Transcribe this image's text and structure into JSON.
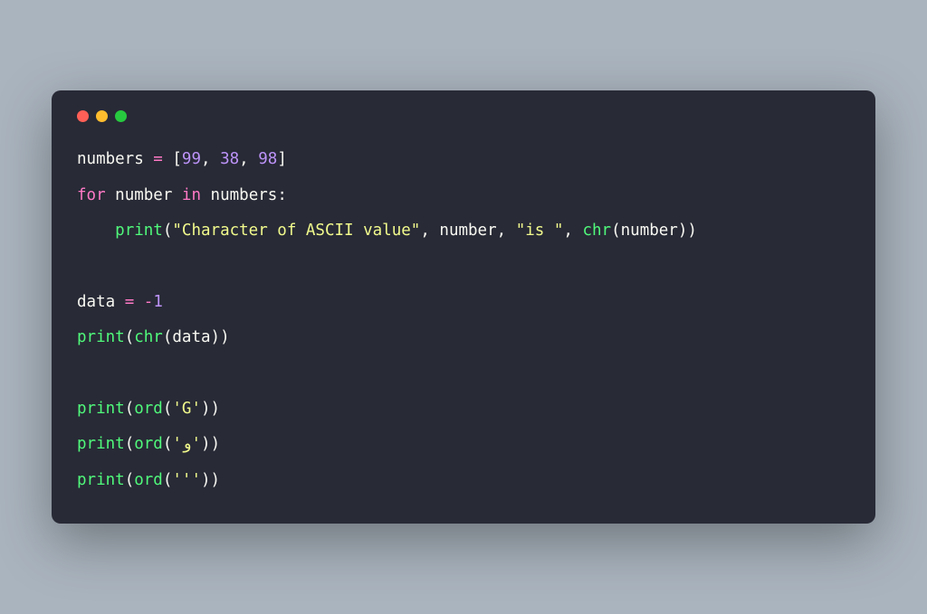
{
  "code": {
    "line1": {
      "var": "numbers",
      "eq": " = ",
      "lb": "[",
      "n1": "99",
      "c1": ", ",
      "n2": "38",
      "c2": ", ",
      "n3": "98",
      "rb": "]"
    },
    "line2": {
      "for": "for",
      "sp1": " ",
      "var": "number",
      "sp2": " ",
      "in": "in",
      "sp3": " ",
      "iter": "numbers",
      "colon": ":"
    },
    "line3": {
      "indent": "    ",
      "print": "print",
      "lp": "(",
      "s1": "\"Character of ASCII value\"",
      "c1": ", ",
      "arg": "number",
      "c2": ", ",
      "s2": "\"is \"",
      "c3": ", ",
      "chr": "chr",
      "lp2": "(",
      "arg2": "number",
      "rp2": ")",
      "rp": ")"
    },
    "blank1": " ",
    "line4": {
      "var": "data",
      "eq": " = ",
      "minus": "-",
      "num": "1"
    },
    "line5": {
      "print": "print",
      "lp": "(",
      "chr": "chr",
      "lp2": "(",
      "arg": "data",
      "rp2": ")",
      "rp": ")"
    },
    "blank2": " ",
    "line6": {
      "print": "print",
      "lp": "(",
      "ord": "ord",
      "lp2": "(",
      "s": "'G'",
      "rp2": ")",
      "rp": ")"
    },
    "line7": {
      "print": "print",
      "lp": "(",
      "ord": "ord",
      "lp2": "(",
      "s": "'و'",
      "rp2": ")",
      "rp": ")"
    },
    "line8": {
      "print": "print",
      "lp": "(",
      "ord": "ord",
      "lp2": "(",
      "s": "'''",
      "rp2": ")",
      "rp": ")"
    }
  }
}
